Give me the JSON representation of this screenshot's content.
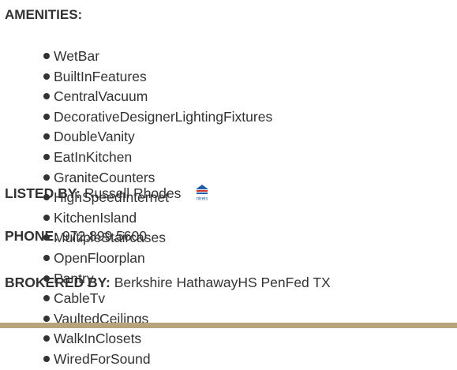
{
  "amenities": {
    "title": "AMENITIES:",
    "items": [
      "WetBar",
      "BuiltInFeatures",
      "CentralVacuum",
      "DecorativeDesignerLightingFixtures",
      "DoubleVanity",
      "EatInKitchen",
      "GraniteCounters",
      "HighSpeedInternet",
      "KitchenIsland",
      "MultipleStaircases",
      "OpenFloorplan",
      "Pantry",
      "CableTv",
      "VaultedCeilings",
      "WalkInClosets",
      "WiredForSound"
    ]
  },
  "listing": {
    "listed_by_label": "LISTED BY:",
    "listed_by_value": "Russell Rhodes",
    "phone_label": "PHONE:",
    "phone_value": "972.899.5600",
    "brokered_by_label": "BROKERED BY:",
    "brokered_by_value": "Berkshire HathawayHS PenFed TX",
    "logo_text": "ntreis"
  },
  "colors": {
    "text": "#333333",
    "divider": "#b8a47c",
    "logo_blue": "#1f5fa8",
    "logo_red": "#d0312d"
  }
}
